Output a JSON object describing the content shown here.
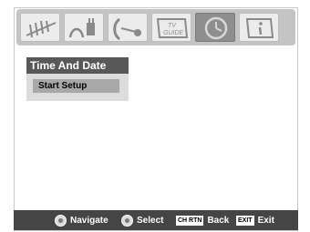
{
  "menu": {
    "title": "Time And Date",
    "items": [
      {
        "label": "Start Setup",
        "selected": true
      }
    ]
  },
  "tabs": {
    "icons": [
      "antenna-icon",
      "plug-icon",
      "satellite-dish-icon",
      "tv-guide-icon",
      "clock-icon",
      "info-icon"
    ],
    "active_index": 4,
    "tv_guide_line1": "TV",
    "tv_guide_line2": "GUIDE"
  },
  "footer": {
    "navigate_label": "Navigate",
    "select_label": "Select",
    "back_key": "CH RTN",
    "back_label": "Back",
    "exit_key": "EXIT",
    "exit_label": "Exit"
  },
  "colors": {
    "menu_title_bg": "#585858",
    "selected_item_bg": "#a8a8a8",
    "footer_bg": "#454545",
    "active_tab_bg": "#8e8e8e"
  }
}
